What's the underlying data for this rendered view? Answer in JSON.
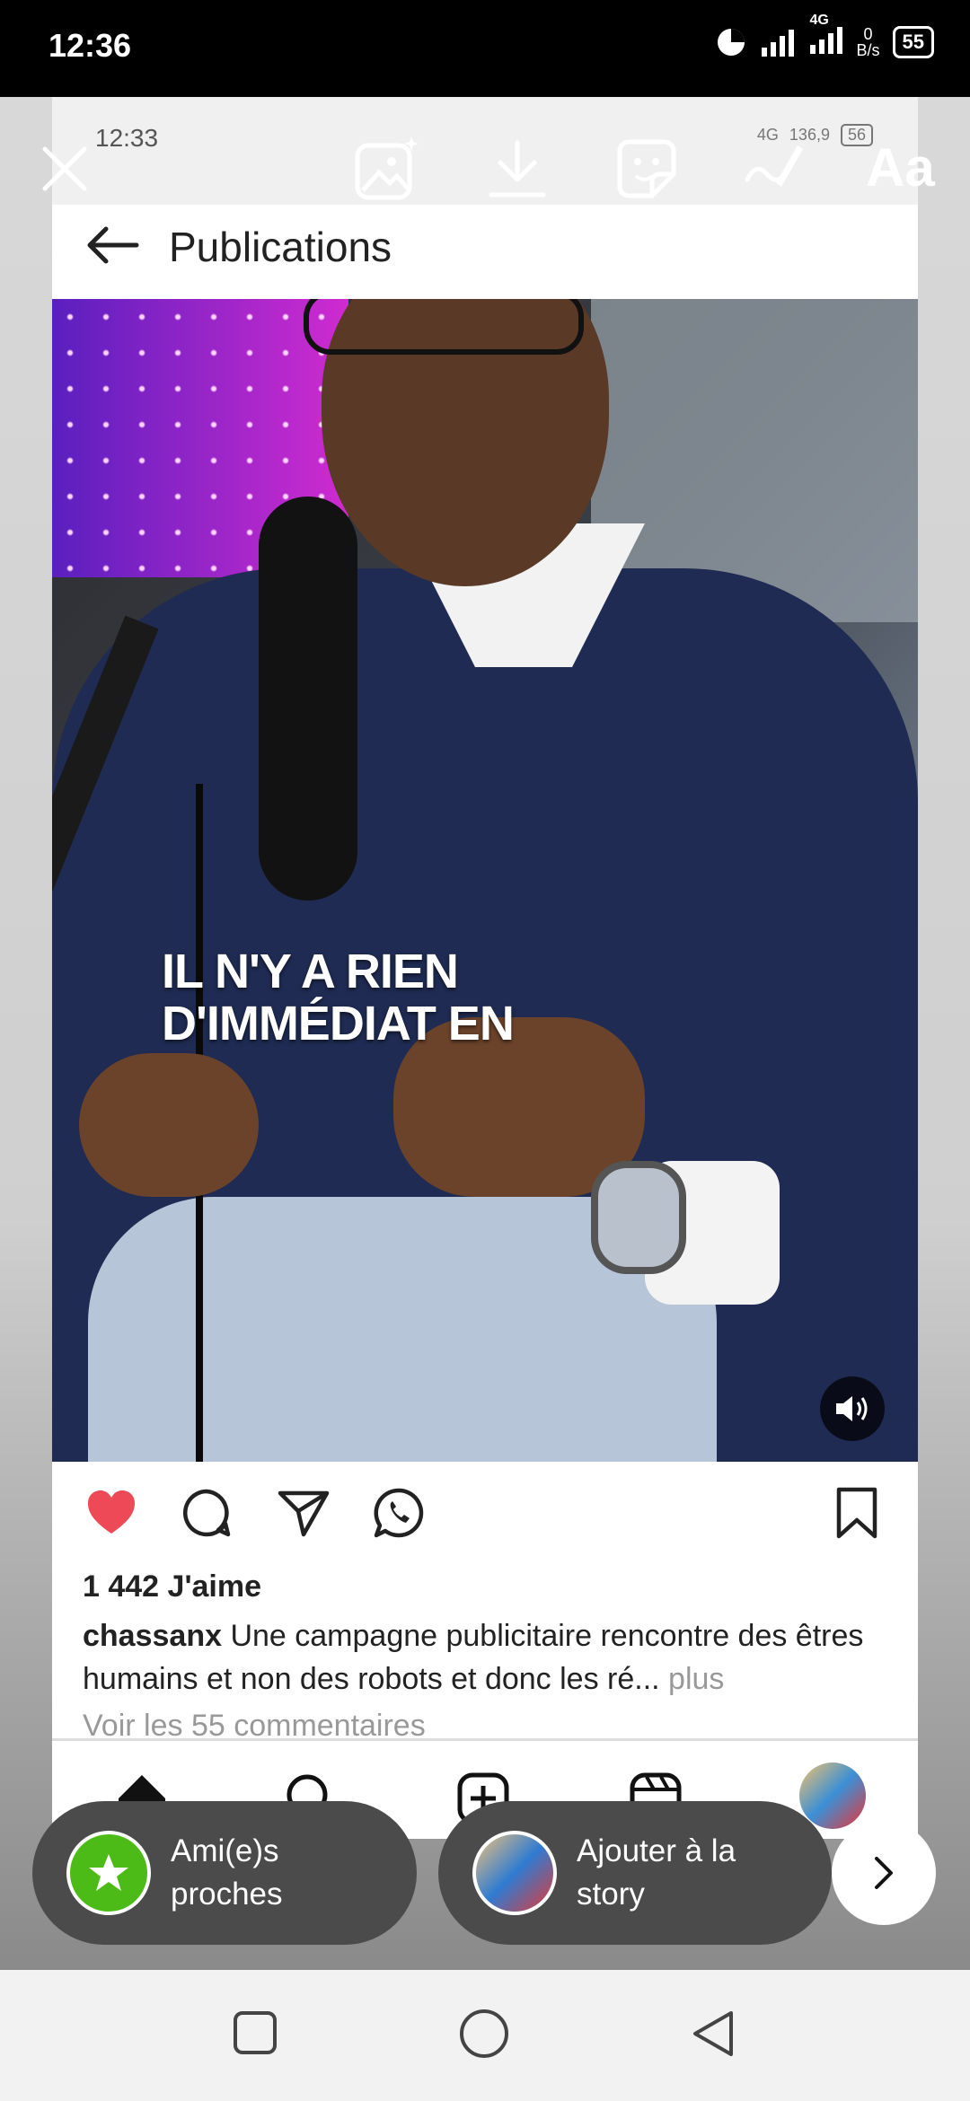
{
  "status_bar": {
    "time": "12:36",
    "network": "4G",
    "data_rate_value": "0",
    "data_rate_unit": "B/s",
    "battery": "55"
  },
  "story_toolbar": {
    "icons": [
      "close-icon",
      "add-photo-sparkle-icon",
      "download-icon",
      "sticker-icon",
      "draw-icon"
    ],
    "text_tool_label": "Aa"
  },
  "inner_screenshot": {
    "status_time": "12:33",
    "status_network": "4G",
    "status_data_rate": "136,9",
    "status_battery": "56",
    "header_title": "Publications",
    "video_caption": "IL N'Y A RIEN\nD'IMMÉDIAT EN",
    "likes_text": "1 442 J'aime",
    "post_username": "chassanx",
    "post_caption": " Une campagne publicitaire rencontre des êtres humains et non des robots et donc les ré",
    "post_caption_ellipsis": "...",
    "post_caption_more": " plus",
    "comments_link": "Voir les 55 commentaires",
    "accent_like_color": "#ed4956"
  },
  "share_bar": {
    "close_friends_label": "Ami(e)s\nproches",
    "add_story_label": "Ajouter à la\nstory",
    "close_friends_color": "#4cbb17"
  }
}
